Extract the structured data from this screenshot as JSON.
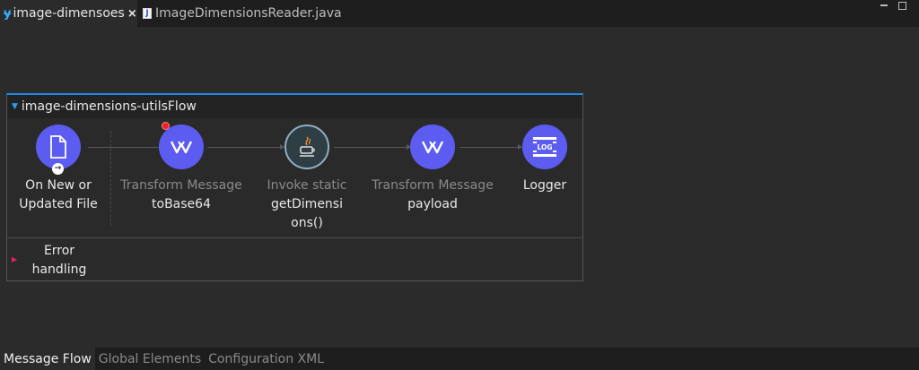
{
  "editor_tabs": [
    {
      "label": "image-dimensoes",
      "icon": "mule-icon",
      "active": true,
      "close": "×"
    },
    {
      "label": "ImageDimensionsReader.java",
      "icon": "java-file-icon",
      "active": false
    }
  ],
  "flow": {
    "name": "image-dimensions-utilsFlow",
    "nodes": [
      {
        "type": "file-listener",
        "icon": "file-icon",
        "title": "On New or",
        "subtitle": "Updated File"
      },
      {
        "type": "transform",
        "icon": "dataweave-icon",
        "title": "Transform Message",
        "subtitle": "toBase64",
        "breakpoint": true
      },
      {
        "type": "invoke-static",
        "icon": "java-icon",
        "title": "Invoke static",
        "subtitle": "getDimensi",
        "subtitle2": "ons()"
      },
      {
        "type": "transform",
        "icon": "dataweave-icon",
        "title": "Transform Message",
        "subtitle": "payload"
      },
      {
        "type": "logger",
        "icon": "log-icon",
        "title": "Logger",
        "badge": "LOG"
      }
    ],
    "error_handling": {
      "line1": "Error",
      "line2": "handling"
    }
  },
  "bottom_tabs": [
    {
      "label": "Message Flow",
      "active": true
    },
    {
      "label": "Global Elements",
      "active": false
    },
    {
      "label": "Configuration XML",
      "active": false
    }
  ],
  "colors": {
    "accent": "#1e88e5",
    "node": "#5c5cf0",
    "breakpoint": "#e8222d",
    "background": "#2b2b2b"
  }
}
